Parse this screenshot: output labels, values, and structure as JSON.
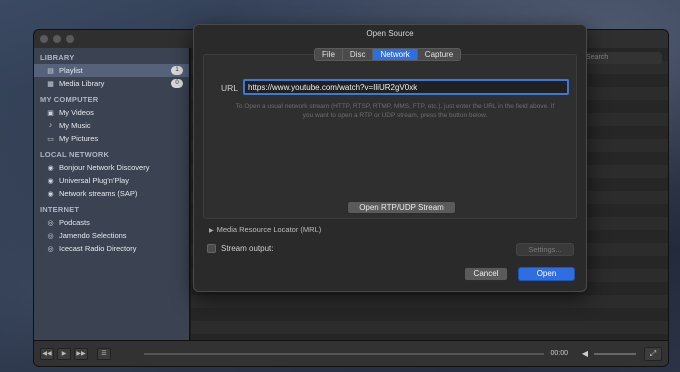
{
  "dialog": {
    "title": "Open Source",
    "tabs": [
      {
        "label": "File"
      },
      {
        "label": "Disc"
      },
      {
        "label": "Network",
        "active": true
      },
      {
        "label": "Capture"
      }
    ],
    "url_label": "URL",
    "url_value": "https://www.youtube.com/watch?v=IliUR2gV0xk",
    "help_text": "To Open a usual network stream (HTTP, RTSP, RTMP, MMS, FTP, etc.), just enter the URL in the field above. If you want to open a RTP or UDP stream, press the button below.",
    "rtp_button": "Open RTP/UDP Stream",
    "mrl_label": "Media Resource Locator (MRL)",
    "stream_output_label": "Stream output:",
    "settings_button": "Settings...",
    "cancel_button": "Cancel",
    "open_button": "Open",
    "accent_color": "#2e6ee0"
  },
  "sidebar": {
    "library": {
      "title": "LIBRARY",
      "items": [
        {
          "label": "Playlist",
          "badge": "1",
          "icon": "playlist-icon",
          "selected": true
        },
        {
          "label": "Media Library",
          "badge": "0",
          "icon": "media-library-icon"
        }
      ]
    },
    "my_computer": {
      "title": "MY COMPUTER",
      "items": [
        {
          "label": "My Videos",
          "icon": "film-icon"
        },
        {
          "label": "My Music",
          "icon": "music-note-icon"
        },
        {
          "label": "My Pictures",
          "icon": "picture-icon"
        }
      ]
    },
    "local_network": {
      "title": "LOCAL NETWORK",
      "items": [
        {
          "label": "Bonjour Network Discovery",
          "icon": "network-icon"
        },
        {
          "label": "Universal Plug'n'Play",
          "icon": "network-icon"
        },
        {
          "label": "Network streams (SAP)",
          "icon": "network-icon"
        }
      ]
    },
    "internet": {
      "title": "INTERNET",
      "items": [
        {
          "label": "Podcasts",
          "icon": "podcast-icon"
        },
        {
          "label": "Jamendo Selections",
          "icon": "podcast-icon"
        },
        {
          "label": "Icecast Radio Directory",
          "icon": "podcast-icon"
        }
      ]
    }
  },
  "content": {
    "search_placeholder": "Search"
  },
  "player": {
    "time": "00:00"
  }
}
